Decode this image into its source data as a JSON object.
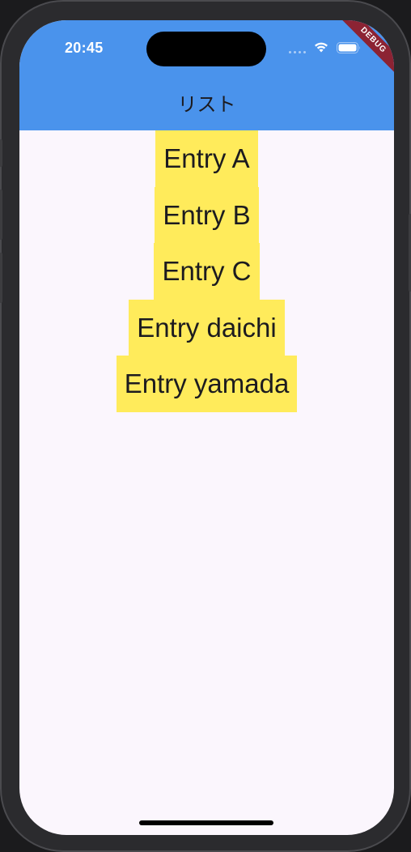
{
  "status_bar": {
    "time": "20:45",
    "debug_banner": "DEBUG"
  },
  "app_bar": {
    "title": "リスト"
  },
  "list": {
    "entries": [
      "Entry A",
      "Entry B",
      "Entry C",
      "Entry daichi",
      "Entry yamada"
    ]
  },
  "colors": {
    "app_bar": "#4a93ec",
    "entry_background": "#ffeb5b",
    "page_background": "#fbf6fd",
    "debug_banner": "#8c2333"
  },
  "icons": {
    "signal": "cellular-signal-icon",
    "wifi": "wifi-icon",
    "battery": "battery-icon"
  }
}
